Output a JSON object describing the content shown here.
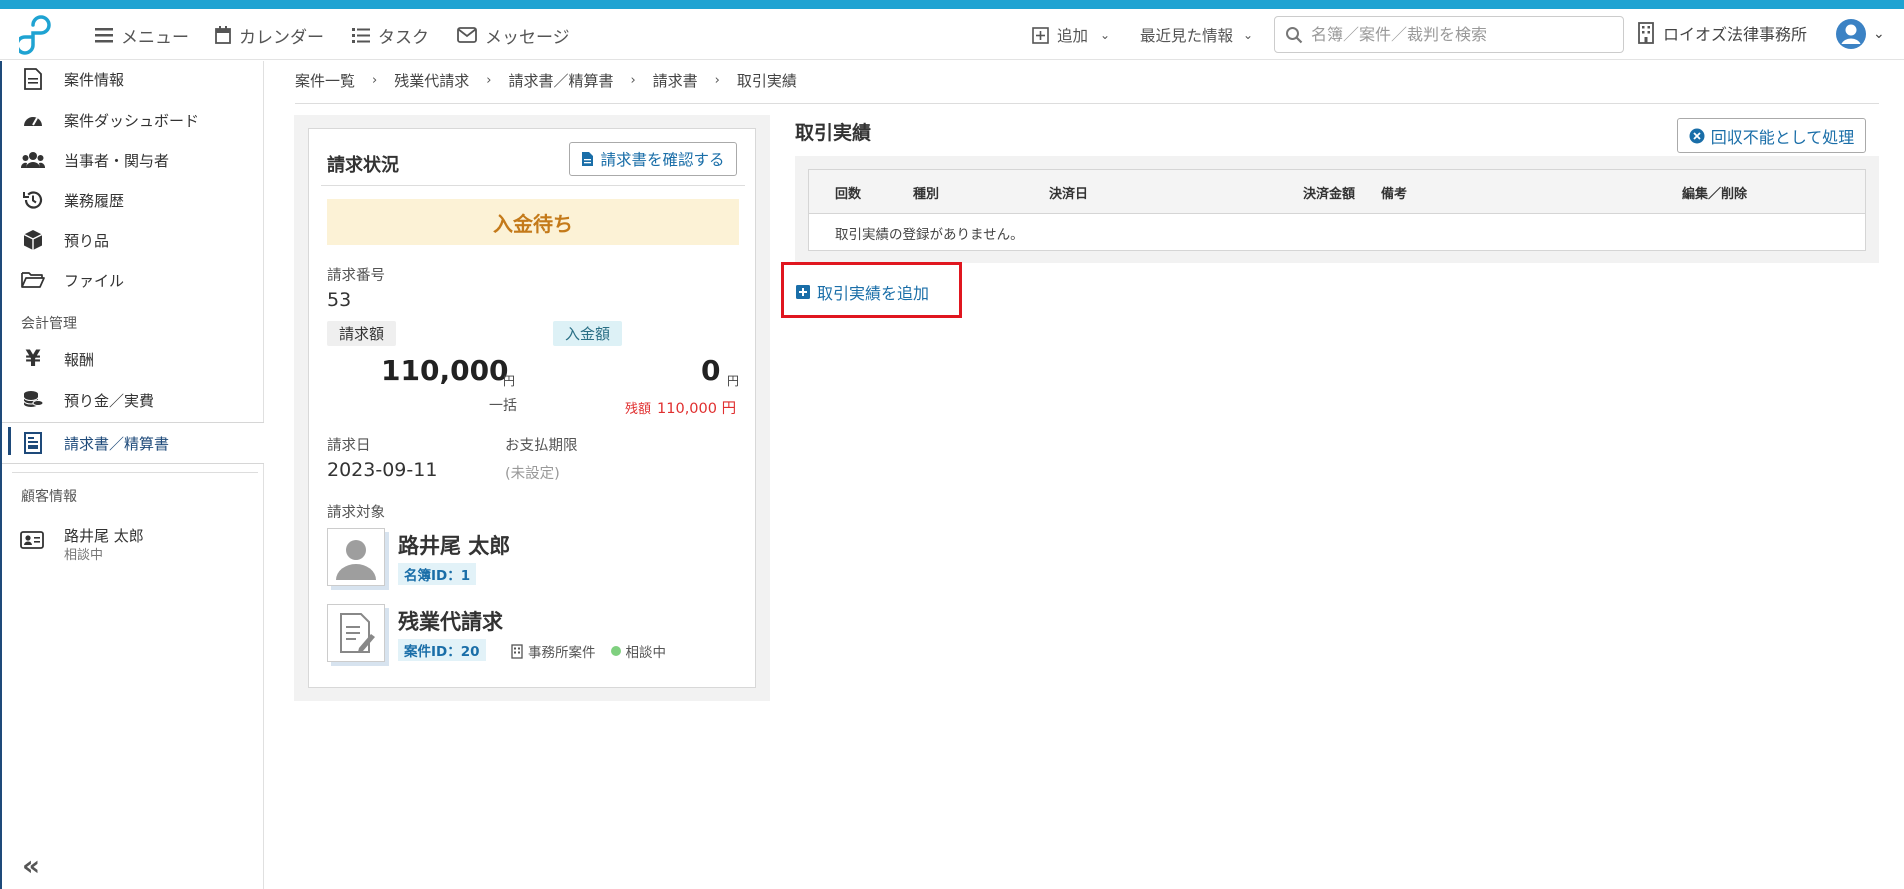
{
  "header": {
    "menu": "メニュー",
    "calendar": "カレンダー",
    "tasks": "タスク",
    "messages": "メッセージ",
    "add": "追加",
    "recent": "最近見た情報",
    "search_placeholder": "名簿／案件／裁判を検索",
    "office": "ロイオズ法律事務所"
  },
  "sidebar": {
    "items": [
      {
        "label": "案件情報",
        "icon": "document-icon"
      },
      {
        "label": "案件ダッシュボード",
        "icon": "gauge-icon"
      },
      {
        "label": "当事者・関与者",
        "icon": "users-icon"
      },
      {
        "label": "業務履歴",
        "icon": "history-icon"
      },
      {
        "label": "預り品",
        "icon": "box-icon"
      },
      {
        "label": "ファイル",
        "icon": "folder-icon"
      }
    ],
    "accounting_section": "会計管理",
    "accounting_items": [
      {
        "label": "報酬",
        "icon": "yen-icon"
      },
      {
        "label": "預り金／実費",
        "icon": "coins-icon"
      },
      {
        "label": "請求書／精算書",
        "icon": "invoice-icon"
      }
    ],
    "client_section": "顧客情報",
    "client": {
      "name": "路井尾 太郎",
      "status": "相談中"
    },
    "collapse": "«"
  },
  "breadcrumb": [
    "案件一覧",
    "残業代請求",
    "請求書／精算書",
    "請求書",
    "取引実績"
  ],
  "breadcrumb_sep": "›",
  "invoice": {
    "title": "請求状況",
    "confirm_button": "請求書を確認する",
    "status": "入金待ち",
    "number_label": "請求番号",
    "number": "53",
    "billed_label": "請求額",
    "paid_label": "入金額",
    "billed_amount": "110,000",
    "paid_amount": "0",
    "yen": "円",
    "payment_type": "一括",
    "remain_label": "残額",
    "remain_amount": "110,000 円",
    "date_label": "請求日",
    "date": "2023-09-11",
    "due_label": "お支払期限",
    "due": "(未設定)",
    "target_label": "請求対象",
    "person": {
      "name": "路井尾 太郎",
      "id": "名簿ID：1"
    },
    "case": {
      "name": "残業代請求",
      "id": "案件ID：20",
      "type": "事務所案件",
      "status": "相談中"
    }
  },
  "transactions": {
    "title": "取引実績",
    "uncollectable_button": "回収不能として処理",
    "columns": [
      "回数",
      "種別",
      "決済日",
      "決済金額",
      "備考",
      "編集／削除"
    ],
    "empty_message": "取引実績の登録がありません。",
    "add_link": "取引実績を追加"
  },
  "colors": {
    "accent": "#1a6ea8",
    "status_warning": "#c47a1a",
    "highlight_box": "#e0161f",
    "top_stripe": "#1fa3d2"
  }
}
